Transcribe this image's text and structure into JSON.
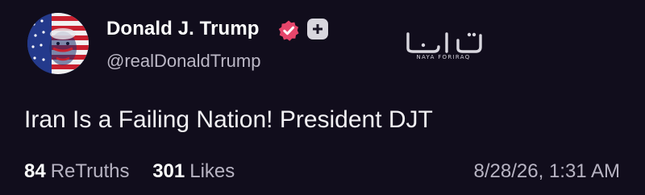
{
  "post": {
    "author": {
      "display_name": "Donald J. Trump",
      "handle": "@realDonaldTrump",
      "verified_icon": "verified-badge-icon",
      "follow_icon": "plus-icon",
      "avatar_icon": "avatar-flag-portrait"
    },
    "watermark": {
      "glyph_text": "نايا",
      "subtext": "NAYA FORIRAQ"
    },
    "text": "Iran Is a Failing Nation! President DJT",
    "stats": {
      "retruths_count": "84",
      "retruths_label": "ReTruths",
      "likes_count": "301",
      "likes_label": "Likes"
    },
    "timestamp": "8/28/26, 1:31 AM"
  },
  "colors": {
    "background": "#110d1c",
    "verified_badge": "#e5466b",
    "primary_text": "#ffffff",
    "secondary_text": "#b7b3c2"
  }
}
